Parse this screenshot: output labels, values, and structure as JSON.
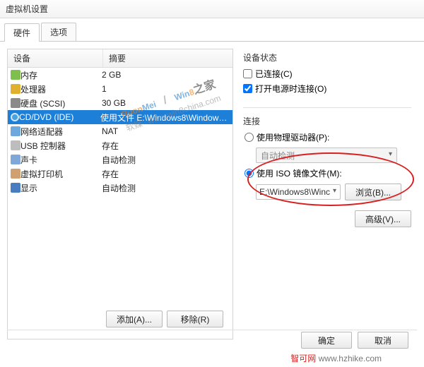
{
  "window": {
    "title": "虚拟机设置"
  },
  "tabs": {
    "hardware": "硬件",
    "options": "选项"
  },
  "columns": {
    "device": "设备",
    "summary": "摘要"
  },
  "devices": [
    {
      "icon": "ic-mem",
      "name": "内存",
      "summary": "2 GB",
      "selected": false
    },
    {
      "icon": "ic-cpu",
      "name": "处理器",
      "summary": "1",
      "selected": false
    },
    {
      "icon": "ic-disk",
      "name": "硬盘 (SCSI)",
      "summary": "30 GB",
      "selected": false
    },
    {
      "icon": "ic-cd",
      "name": "CD/DVD (IDE)",
      "summary": "使用文件 E:\\Windows8\\Windows8...",
      "selected": true
    },
    {
      "icon": "ic-net",
      "name": "网络适配器",
      "summary": "NAT",
      "selected": false
    },
    {
      "icon": "ic-usb",
      "name": "USB 控制器",
      "summary": "存在",
      "selected": false
    },
    {
      "icon": "ic-sound",
      "name": "声卡",
      "summary": "自动检测",
      "selected": false
    },
    {
      "icon": "ic-print",
      "name": "虚拟打印机",
      "summary": "存在",
      "selected": false
    },
    {
      "icon": "ic-display",
      "name": "显示",
      "summary": "自动检测",
      "selected": false
    }
  ],
  "left_buttons": {
    "add": "添加(A)...",
    "remove": "移除(R)"
  },
  "status": {
    "group": "设备状态",
    "connected": "已连接(C)",
    "connected_checked": false,
    "power_on": "打开电源时连接(O)",
    "power_on_checked": true
  },
  "connection": {
    "group": "连接",
    "use_physical": "使用物理驱动器(P):",
    "physical_value": "自动检测",
    "use_iso": "使用 ISO 镜像文件(M):",
    "iso_value": "E:\\Windows8\\Winc",
    "browse": "浏览(B)...",
    "advanced": "高级(V)..."
  },
  "bottom": {
    "ok": "确定",
    "cancel": "取消"
  },
  "watermark": {
    "ruonmei": {
      "a": "Ruon",
      "b": "Mei",
      "cn": "软媒"
    },
    "win8": {
      "a": "Win",
      "b": "8",
      "cn": "之家",
      "url": "www.win8china.com"
    },
    "footer_cn": "智可网",
    "footer_url": "www.hzhike.com"
  }
}
